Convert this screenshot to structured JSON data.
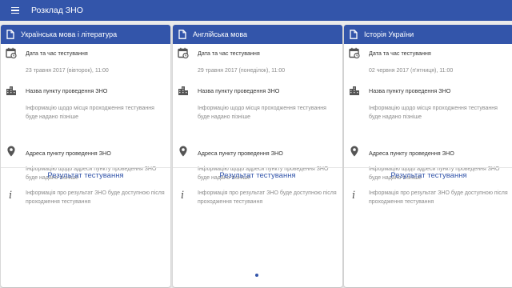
{
  "app": {
    "title": "Розклад ЗНО"
  },
  "labels": {
    "date_time": "Дата та час тестування",
    "place_name": "Назва пункту проведення ЗНО",
    "place_address": "Адреса пункту проведення ЗНО",
    "result": "Результат тестування"
  },
  "cards": [
    {
      "subject": "Українська мова і література",
      "date": "23 травня 2017 (вівторок), 11:00",
      "place_info": "Інформацію щодо місця проходження тестування буде надано пізніше",
      "address_info": "Інформацію щодо адреси пункту проведення ЗНО буде надано пізніше",
      "result_info": "Інформація про результат ЗНО буде доступною після проходження тестування"
    },
    {
      "subject": "Англійська мова",
      "date": "29 травня 2017 (понеділок), 11:00",
      "place_info": "Інформацію щодо місця проходження тестування буде надано пізніше",
      "address_info": "Інформацію щодо адреси пункту проведення ЗНО буде надано пізніше",
      "result_info": "Інформація про результат ЗНО буде доступною після проходження тестування"
    },
    {
      "subject": "Історія України",
      "date": "02 червня 2017 (п'ятниця), 11:00",
      "place_info": "Інформацію щодо місця проходження тестування буде надано пізніше",
      "address_info": "Інформацію щодо адреси пункту проведення ЗНО буде надано пізніше",
      "result_info": "Інформація про результат ЗНО буде доступною після проходження тестування"
    }
  ],
  "colors": {
    "primary": "#3355aa",
    "background": "#ebebeb"
  },
  "icons": [
    "menu-icon",
    "document-icon",
    "calendar-icon",
    "building-icon",
    "location-pin-icon",
    "info-icon"
  ]
}
